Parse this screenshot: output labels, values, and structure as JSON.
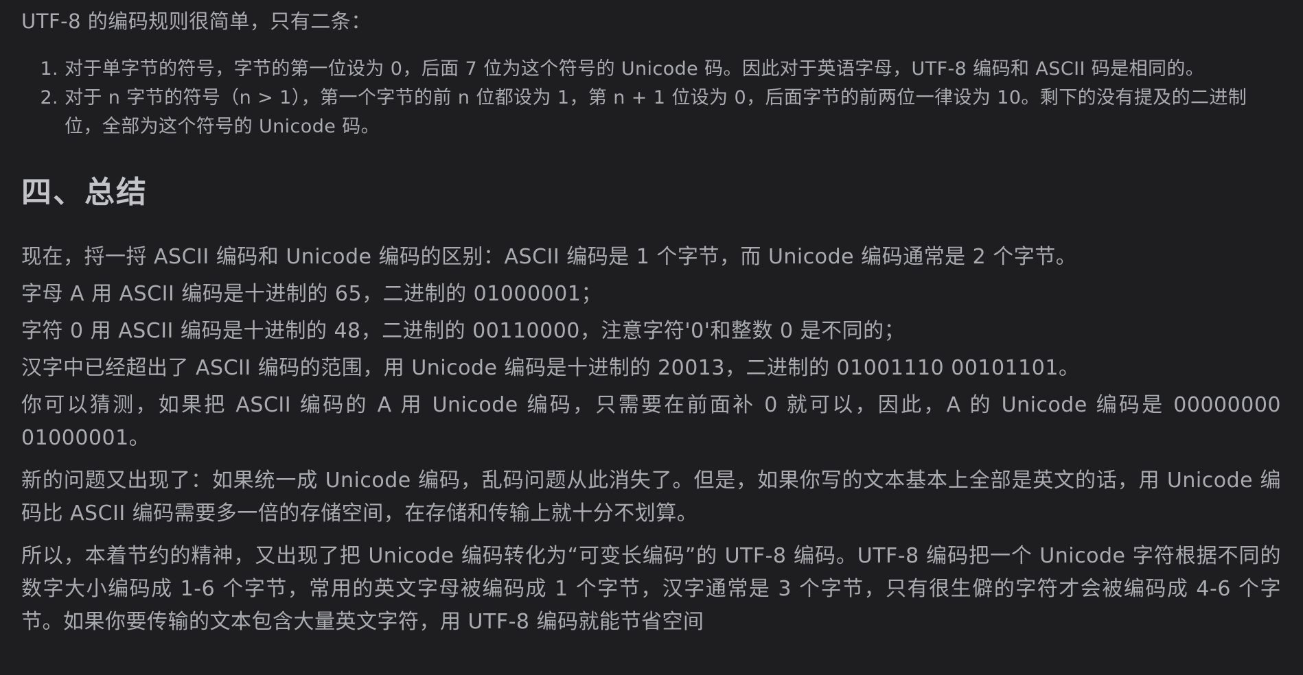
{
  "intro": "UTF-8 的编码规则很简单，只有二条：",
  "rules": [
    "对于单字节的符号，字节的第一位设为 0，后面 7 位为这个符号的 Unicode 码。因此对于英语字母，UTF-8 编码和 ASCII 码是相同的。",
    "对于 n 字节的符号（n > 1），第一个字节的前 n 位都设为 1，第 n + 1 位设为 0，后面字节的前两位一律设为 10。剩下的没有提及的二进制位，全部为这个符号的 Unicode 码。"
  ],
  "section_title": "四、总结",
  "paragraphs": [
    "现在，捋一捋 ASCII 编码和 Unicode 编码的区别：ASCII 编码是 1 个字节，而 Unicode 编码通常是 2 个字节。",
    "字母 A 用 ASCII 编码是十进制的 65，二进制的 01000001；",
    "字符 0 用 ASCII 编码是十进制的 48，二进制的 00110000，注意字符'0'和整数 0 是不同的；",
    "汉字中已经超出了 ASCII 编码的范围，用 Unicode 编码是十进制的 20013，二进制的 01001110 00101101。",
    "你可以猜测，如果把 ASCII 编码的 A 用 Unicode 编码，只需要在前面补 0 就可以，因此，A 的 Unicode 编码是 00000000 01000001。",
    "新的问题又出现了：如果统一成 Unicode 编码，乱码问题从此消失了。但是，如果你写的文本基本上全部是英文的话，用 Unicode 编码比 ASCII 编码需要多一倍的存储空间，在存储和传输上就十分不划算。",
    "所以，本着节约的精神，又出现了把 Unicode 编码转化为“可变长编码”的 UTF-8 编码。UTF-8 编码把一个 Unicode 字符根据不同的数字大小编码成 1-6 个字节，常用的英文字母被编码成 1 个字节，汉字通常是 3 个字节，只有很生僻的字符才会被编码成 4-6 个字节。如果你要传输的文本包含大量英文字符，用 UTF-8 编码就能节省空间"
  ],
  "colors": {
    "background": "#1e1e20",
    "text": "#a9abaf",
    "heading": "#c2c4c8"
  }
}
